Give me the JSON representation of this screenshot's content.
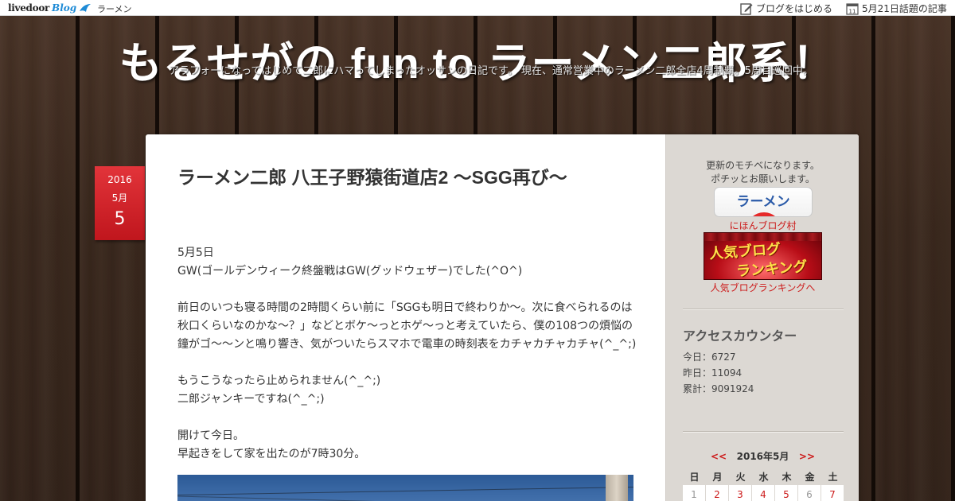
{
  "topbar": {
    "logo_main": "livedoor",
    "logo_blog": "Blog",
    "crumb": "ラーメン",
    "start_blog": "ブログをはじめる",
    "news_label": "5月21日話題の記事",
    "news_icon_day": "11"
  },
  "header": {
    "title": "もるせがの fun to ラーメン二郎系！",
    "description": "アラフォーになってはじめて二郎にハマってしまったオッサンの日記です。 現在、通常営業中のラーメン二郎全店4周制覇。5周目巡回中。"
  },
  "post": {
    "date": {
      "year": "2016",
      "month": "5月",
      "day": "5"
    },
    "title": "ラーメン二郎 八王子野猿街道店2 〜SGG再び〜",
    "lines": {
      "l1": "5月5日",
      "l2": "GW(ゴールデンウィーク終盤戦はGW(グッドウェザー)でした(^O^)",
      "l3": "前日のいつも寝る時間の2時間くらい前に「SGGも明日で終わりか〜。次に食べられるのは",
      "l4": "秋口くらいなのかな〜？」などとボケ〜っとホゲ〜っと考えていたら、僕の108つの煩悩の",
      "l5": "鐘がゴ〜〜ンと鳴り響き、気がついたらスマホで電車の時刻表をカチャカチャカチャ(^_^;)",
      "l6": "もうこうなったら止められません(^_^;)",
      "l7": "二郎ジャンキーですね(^_^;)",
      "l8": "開けて今日。",
      "l9": "早起きをして家を出たのが7時30分。"
    }
  },
  "sidebar": {
    "motive_1": "更新のモチベになります。",
    "motive_2": "ポチッとお願いします。",
    "ramen_button": "ラーメン",
    "nihon_link": "にほんブログ村",
    "rank_banner_1": "人気ブログ",
    "rank_banner_2": "ランキング",
    "rank_link": "人気ブログランキングへ",
    "counter_heading": "アクセスカウンター",
    "counter_today": "今日：6727",
    "counter_yesterday": "昨日：11094",
    "counter_total": "累計：9091924",
    "calendar": {
      "prev": "<<",
      "month": "2016年5月",
      "next": ">>",
      "weekdays": [
        "日",
        "月",
        "火",
        "水",
        "木",
        "金",
        "土"
      ],
      "first_week": [
        "1",
        "2",
        "3",
        "4",
        "5",
        "6",
        "7"
      ]
    }
  },
  "colors": {
    "accent_red": "#cc1a1a",
    "date_badge": "#d1232a",
    "sidebar_bg": "#dcd8d3",
    "link_blue": "#1e8bd6"
  }
}
